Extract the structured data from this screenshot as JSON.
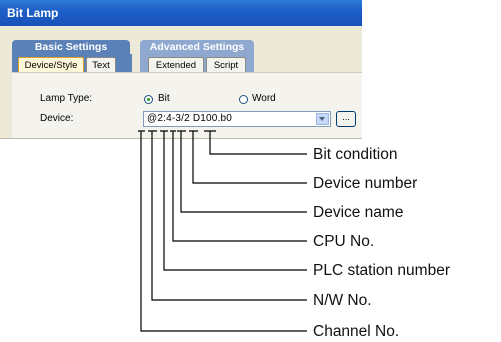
{
  "dialog": {
    "title": "Bit Lamp",
    "groups": [
      "Basic Settings",
      "Advanced Settings"
    ],
    "tabs": [
      "Device/Style",
      "Text",
      "Extended",
      "Script"
    ],
    "active_tab": "Device/Style",
    "lamp_type_label": "Lamp Type:",
    "lamp_type_options": [
      "Bit",
      "Word"
    ],
    "lamp_type_selected": "Bit",
    "device_label": "Device:",
    "device_value": "@2:4-3/2 D100.b0",
    "browse_label": "..."
  },
  "callouts": [
    "Bit condition",
    "Device number",
    "Device name",
    "CPU No.",
    "PLC station number",
    "N/W No.",
    "Channel No."
  ]
}
